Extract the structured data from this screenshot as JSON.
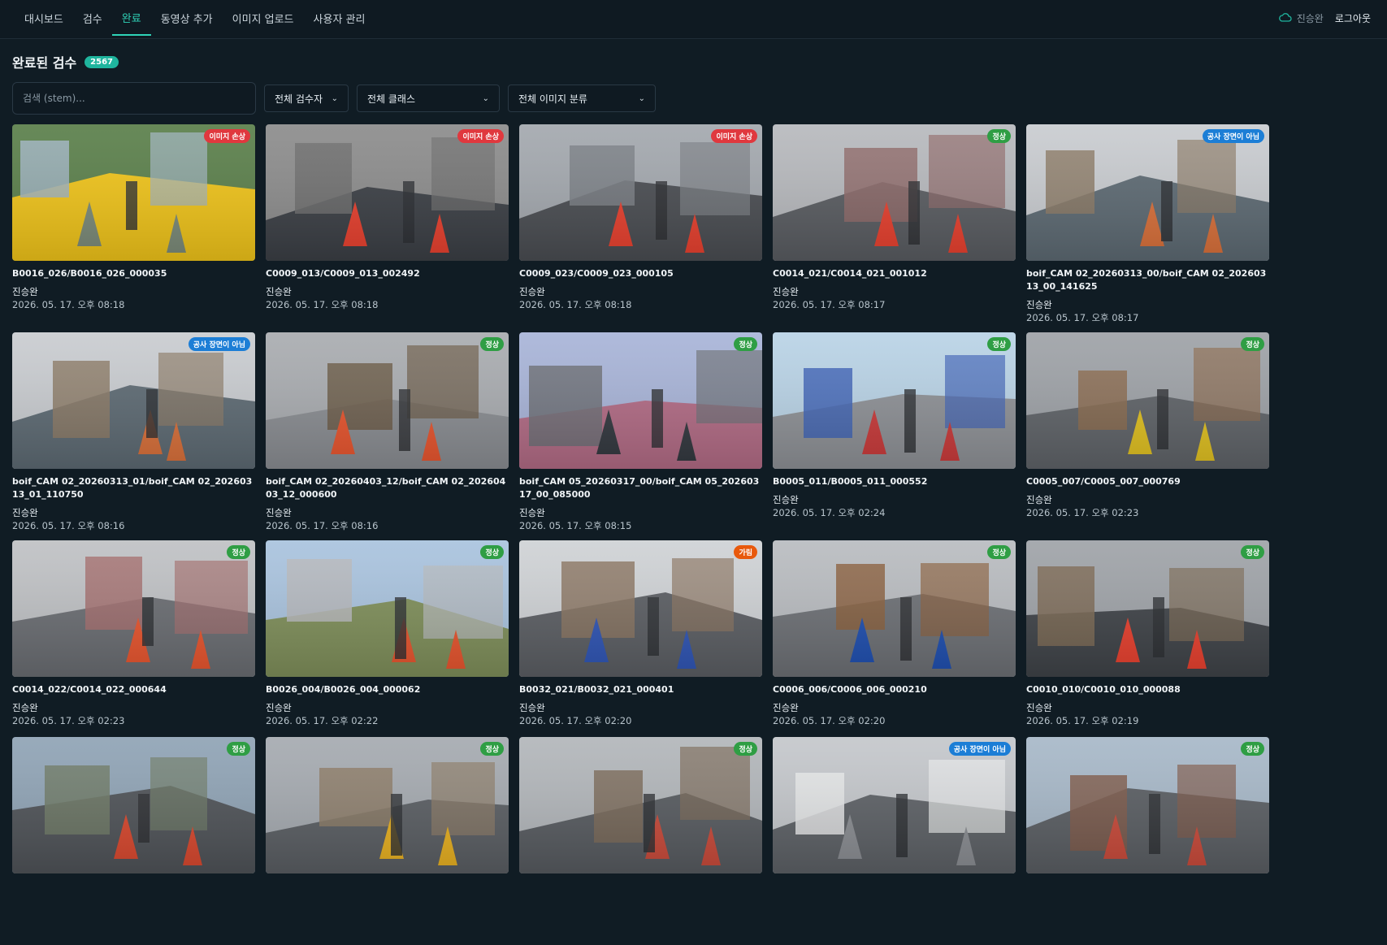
{
  "nav": {
    "tabs": [
      "대시보드",
      "검수",
      "완료",
      "동영상 추가",
      "이미지 업로드",
      "사용자 관리"
    ],
    "active_index": 2,
    "user": "진승완",
    "logout": "로그아웃"
  },
  "page": {
    "title": "완료된 검수",
    "count": "2567"
  },
  "filters": {
    "search_placeholder": "검색 (stem)...",
    "reviewer": "전체 검수자",
    "class": "전체 클래스",
    "image_category": "전체 이미지 분류"
  },
  "colors": {
    "accent": "#2fd3b8",
    "damaged": "#e0383e",
    "normal": "#2f9e44",
    "not_construction": "#1c7ed6",
    "obscured": "#e8590c"
  },
  "cards": [
    {
      "filename": "B0016_026/B0016_026_000035",
      "reviewer": "진승완",
      "time": "2026. 05. 17. 오후 08:18",
      "badge": "이미지 손상",
      "badge_type": "damaged",
      "scene": [
        "#5a7f4a",
        "#9fb3c0",
        "#7b8a78",
        "#f0c419"
      ]
    },
    {
      "filename": "C0009_013/C0009_013_002492",
      "reviewer": "진승완",
      "time": "2026. 05. 17. 오후 08:18",
      "badge": "이미지 손상",
      "badge_type": "damaged",
      "scene": [
        "#8c8c8c",
        "#6d6d6d",
        "#e8402e",
        "#3b3f45"
      ]
    },
    {
      "filename": "C0009_023/C0009_023_000105",
      "reviewer": "진승완",
      "time": "2026. 05. 17. 오후 08:18",
      "badge": "이미지 손상",
      "badge_type": "damaged",
      "scene": [
        "#a3a8ae",
        "#7a7f85",
        "#e8402e",
        "#4a4d52"
      ]
    },
    {
      "filename": "C0014_021/C0014_021_001012",
      "reviewer": "진승완",
      "time": "2026. 05. 17. 오후 08:17",
      "badge": "정상",
      "badge_type": "normal",
      "scene": [
        "#b7b9bd",
        "#8f6a6a",
        "#e8402e",
        "#595c61"
      ]
    },
    {
      "filename": "boif_CAM 02_20260313_00/boif_CAM 02_20260313_00_141625",
      "reviewer": "진승완",
      "time": "2026. 05. 17. 오후 08:17",
      "badge": "공사 장면이 아님",
      "badge_type": "not_construction",
      "scene": [
        "#c9ccd0",
        "#8c7a66",
        "#d9703a",
        "#5d6a73"
      ]
    },
    {
      "filename": "boif_CAM 02_20260313_01/boif_CAM 02_20260313_01_110750",
      "reviewer": "진승완",
      "time": "2026. 05. 17. 오후 08:16",
      "badge": "공사 장면이 아님",
      "badge_type": "not_construction",
      "scene": [
        "#c9ccd0",
        "#8c7a66",
        "#d9703a",
        "#5d6a73"
      ]
    },
    {
      "filename": "boif_CAM 02_20260403_12/boif_CAM 02_20260403_12_000600",
      "reviewer": "진승완",
      "time": "2026. 05. 17. 오후 08:16",
      "badge": "정상",
      "badge_type": "normal",
      "scene": [
        "#a9acb0",
        "#6b5a46",
        "#e8552e",
        "#8a8d92"
      ]
    },
    {
      "filename": "boif_CAM 05_20260317_00/boif_CAM 05_20260317_00_085000",
      "reviewer": "진승완",
      "time": "2026. 05. 17. 오후 08:15",
      "badge": "정상",
      "badge_type": "normal",
      "scene": [
        "#a8b4d8",
        "#6c6f76",
        "#33383f",
        "#b26b85"
      ]
    },
    {
      "filename": "B0005_011/B0005_011_000552",
      "reviewer": "진승완",
      "time": "2026. 05. 17. 오후 02:24",
      "badge": "정상",
      "badge_type": "normal",
      "scene": [
        "#b9d3e6",
        "#3e63b6",
        "#c93a3a",
        "#8e9196"
      ]
    },
    {
      "filename": "C0005_007/C0005_007_000769",
      "reviewer": "진승완",
      "time": "2026. 05. 17. 오후 02:23",
      "badge": "정상",
      "badge_type": "normal",
      "scene": [
        "#9ea2a7",
        "#8b6b4f",
        "#e0c020",
        "#5f6368"
      ]
    },
    {
      "filename": "C0014_022/C0014_022_000644",
      "reviewer": "진승완",
      "time": "2026. 05. 17. 오후 02:23",
      "badge": "정상",
      "badge_type": "normal",
      "scene": [
        "#bfc1c4",
        "#a36e6e",
        "#e8552e",
        "#6a6d72"
      ]
    },
    {
      "filename": "B0026_004/B0026_004_000062",
      "reviewer": "진승완",
      "time": "2026. 05. 17. 오후 02:22",
      "badge": "정상",
      "badge_type": "normal",
      "scene": [
        "#a9c3de",
        "#b7b9bc",
        "#e8552e",
        "#7f8f5a"
      ]
    },
    {
      "filename": "B0032_021/B0032_021_000401",
      "reviewer": "진승완",
      "time": "2026. 05. 17. 오후 02:20",
      "badge": "가림",
      "badge_type": "obscured",
      "scene": [
        "#cfd2d5",
        "#8a7460",
        "#2f55b5",
        "#5b5e63"
      ]
    },
    {
      "filename": "C0006_006/C0006_006_000210",
      "reviewer": "진승완",
      "time": "2026. 05. 17. 오후 02:20",
      "badge": "정상",
      "badge_type": "normal",
      "scene": [
        "#b9bcc0",
        "#8a5f3d",
        "#1f4fb0",
        "#6d7075"
      ]
    },
    {
      "filename": "C0010_010/C0010_010_000088",
      "reviewer": "진승완",
      "time": "2026. 05. 17. 오후 02:19",
      "badge": "정상",
      "badge_type": "normal",
      "scene": [
        "#9fa3a8",
        "#7c6a55",
        "#e8402e",
        "#3f4348"
      ]
    },
    {
      "filename": "",
      "reviewer": "",
      "time": "",
      "badge": "정상",
      "badge_type": "normal",
      "scene": [
        "#8fa3b5",
        "#6e7a66",
        "#d9482e",
        "#4f5358"
      ]
    },
    {
      "filename": "",
      "reviewer": "",
      "time": "",
      "badge": "정상",
      "badge_type": "normal",
      "scene": [
        "#a5aab0",
        "#8c7b66",
        "#e8b020",
        "#5a5e63"
      ]
    },
    {
      "filename": "",
      "reviewer": "",
      "time": "",
      "badge": "정상",
      "badge_type": "normal",
      "scene": [
        "#b2b6ba",
        "#7a6a58",
        "#c94a3a",
        "#575b60"
      ]
    },
    {
      "filename": "",
      "reviewer": "",
      "time": "",
      "badge": "공사 장면이 아님",
      "badge_type": "not_construction",
      "scene": [
        "#c4c7cb",
        "#e8e9ea",
        "#8a8d92",
        "#5d6166"
      ]
    },
    {
      "filename": "",
      "reviewer": "",
      "time": "",
      "badge": "정상",
      "badge_type": "normal",
      "scene": [
        "#a7b8c8",
        "#7f5a4a",
        "#c94a3a",
        "#5a5e63"
      ]
    }
  ]
}
